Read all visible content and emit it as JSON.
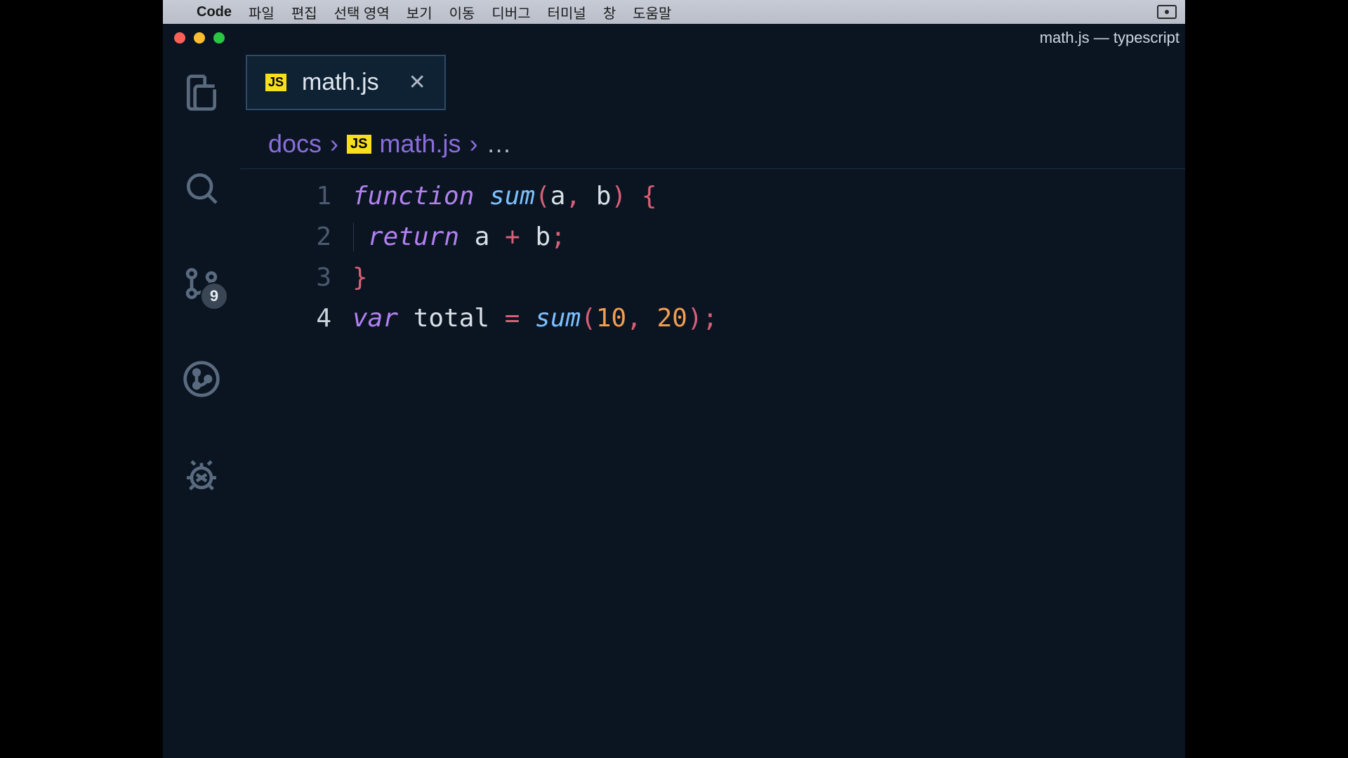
{
  "macos_menu": {
    "app_name": "Code",
    "items": [
      "파일",
      "편집",
      "선택 영역",
      "보기",
      "이동",
      "디버그",
      "터미널",
      "창",
      "도움말"
    ]
  },
  "window_title": "math.js — typescript",
  "tab": {
    "label": "math.js",
    "icon_text": "JS"
  },
  "breadcrumbs": {
    "root": "docs",
    "file": "math.js",
    "trailing": "…",
    "icon_text": "JS"
  },
  "activitybar": {
    "scm_badge": "9"
  },
  "code": {
    "lines": [
      {
        "n": "1",
        "tokens": [
          {
            "t": "function",
            "c": "kw"
          },
          {
            "t": " ",
            "c": ""
          },
          {
            "t": "sum",
            "c": "fn"
          },
          {
            "t": "(",
            "c": "punc"
          },
          {
            "t": "a",
            "c": "param"
          },
          {
            "t": ",",
            "c": "punc"
          },
          {
            "t": " ",
            "c": ""
          },
          {
            "t": "b",
            "c": "param"
          },
          {
            "t": ")",
            "c": "punc"
          },
          {
            "t": " ",
            "c": ""
          },
          {
            "t": "{",
            "c": "punc"
          }
        ]
      },
      {
        "n": "2",
        "indent": true,
        "tokens": [
          {
            "t": "return",
            "c": "kw"
          },
          {
            "t": " ",
            "c": ""
          },
          {
            "t": "a",
            "c": "vn"
          },
          {
            "t": " ",
            "c": ""
          },
          {
            "t": "+",
            "c": "op"
          },
          {
            "t": " ",
            "c": ""
          },
          {
            "t": "b",
            "c": "vn"
          },
          {
            "t": ";",
            "c": "punc"
          }
        ]
      },
      {
        "n": "3",
        "tokens": [
          {
            "t": "}",
            "c": "punc"
          }
        ]
      },
      {
        "n": "4",
        "current": true,
        "tokens": [
          {
            "t": "var",
            "c": "kw"
          },
          {
            "t": " ",
            "c": ""
          },
          {
            "t": "total",
            "c": "vn"
          },
          {
            "t": " ",
            "c": ""
          },
          {
            "t": "=",
            "c": "op"
          },
          {
            "t": " ",
            "c": ""
          },
          {
            "t": "sum",
            "c": "fn"
          },
          {
            "t": "(",
            "c": "punc"
          },
          {
            "t": "10",
            "c": "num"
          },
          {
            "t": ",",
            "c": "punc"
          },
          {
            "t": " ",
            "c": ""
          },
          {
            "t": "20",
            "c": "num"
          },
          {
            "t": ")",
            "c": "punc"
          },
          {
            "t": ";",
            "c": "punc"
          }
        ]
      }
    ]
  }
}
